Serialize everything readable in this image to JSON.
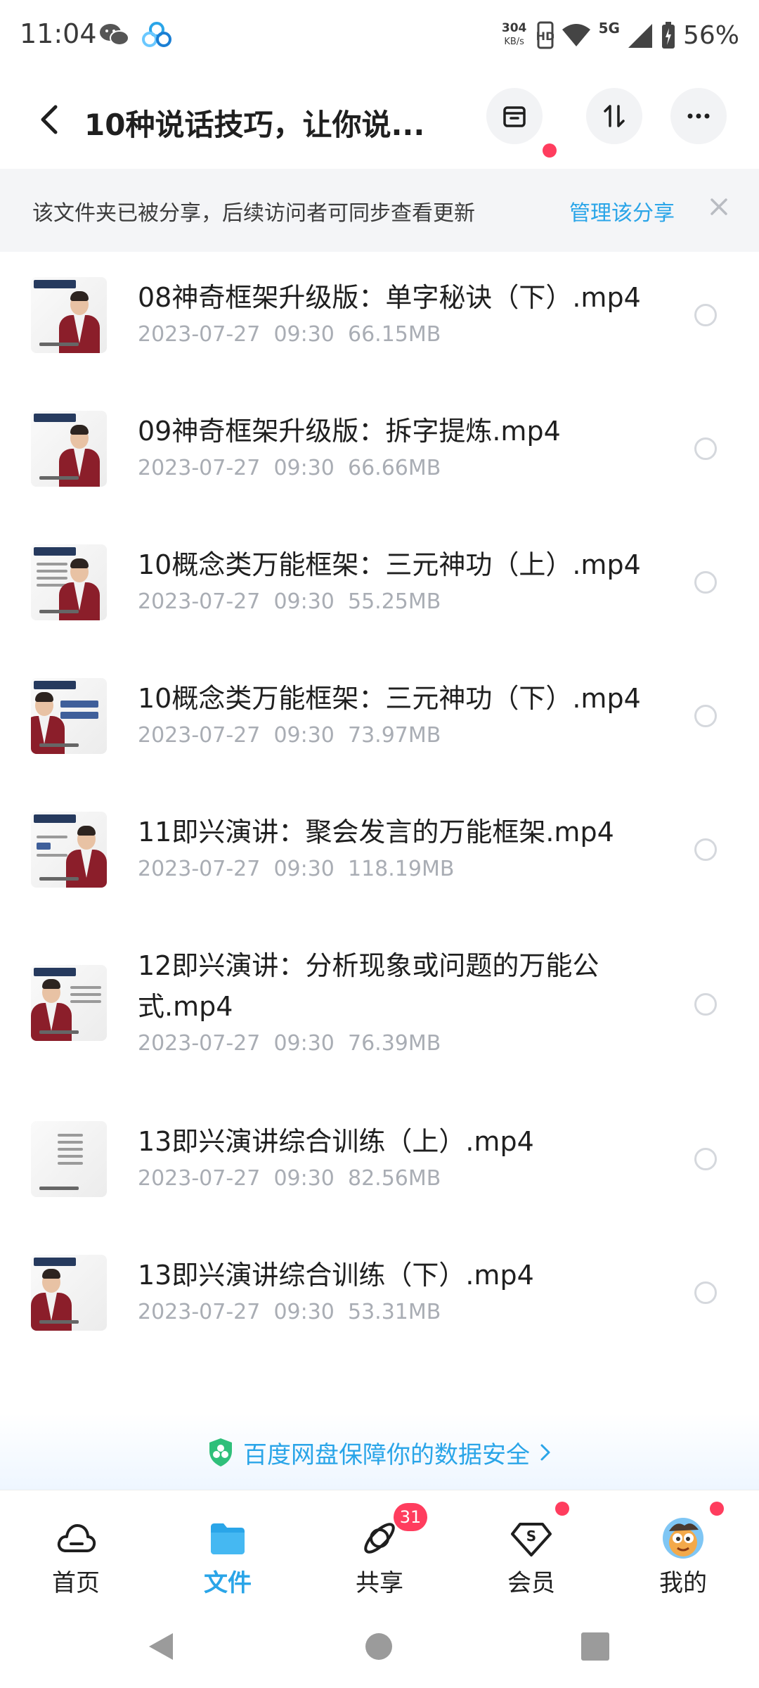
{
  "status_bar": {
    "time": "11:04",
    "speed_value": "304",
    "speed_unit": "KB/s",
    "network": "5G",
    "battery": "56%"
  },
  "header": {
    "title": "10种说话技巧，让你说..."
  },
  "banner": {
    "text": "该文件夹已被分享，后续访问者可同步查看更新",
    "link": "管理该分享"
  },
  "files": [
    {
      "name": "08神奇框架升级版：单字秘诀（下）.mp4",
      "date": "2023-07-27",
      "time": "09:30",
      "size": "66.15MB"
    },
    {
      "name": "09神奇框架升级版：拆字提炼.mp4",
      "date": "2023-07-27",
      "time": "09:30",
      "size": "66.66MB"
    },
    {
      "name": "10概念类万能框架：三元神功（上）.mp4",
      "date": "2023-07-27",
      "time": "09:30",
      "size": "55.25MB"
    },
    {
      "name": "10概念类万能框架：三元神功（下）.mp4",
      "date": "2023-07-27",
      "time": "09:30",
      "size": "73.97MB"
    },
    {
      "name": "11即兴演讲：聚会发言的万能框架.mp4",
      "date": "2023-07-27",
      "time": "09:30",
      "size": "118.19MB"
    },
    {
      "name": "12即兴演讲：分析现象或问题的万能公式.mp4",
      "date": "2023-07-27",
      "time": "09:30",
      "size": "76.39MB"
    },
    {
      "name": "13即兴演讲综合训练（上）.mp4",
      "date": "2023-07-27",
      "time": "09:30",
      "size": "82.56MB"
    },
    {
      "name": "13即兴演讲综合训练（下）.mp4",
      "date": "2023-07-27",
      "time": "09:30",
      "size": "53.31MB"
    }
  ],
  "security": {
    "text": "百度网盘保障你的数据安全"
  },
  "tabs": [
    {
      "label": "首页",
      "icon": "cloud-icon"
    },
    {
      "label": "文件",
      "icon": "folder-icon",
      "active": true
    },
    {
      "label": "共享",
      "icon": "orbit-icon",
      "badge": "31"
    },
    {
      "label": "会员",
      "icon": "vip-diamond-icon"
    },
    {
      "label": "我的",
      "icon": "avatar"
    }
  ],
  "colors": {
    "accent": "#2aa5e8",
    "badge": "#ff3d5e",
    "meta_text": "#a9adb4"
  }
}
